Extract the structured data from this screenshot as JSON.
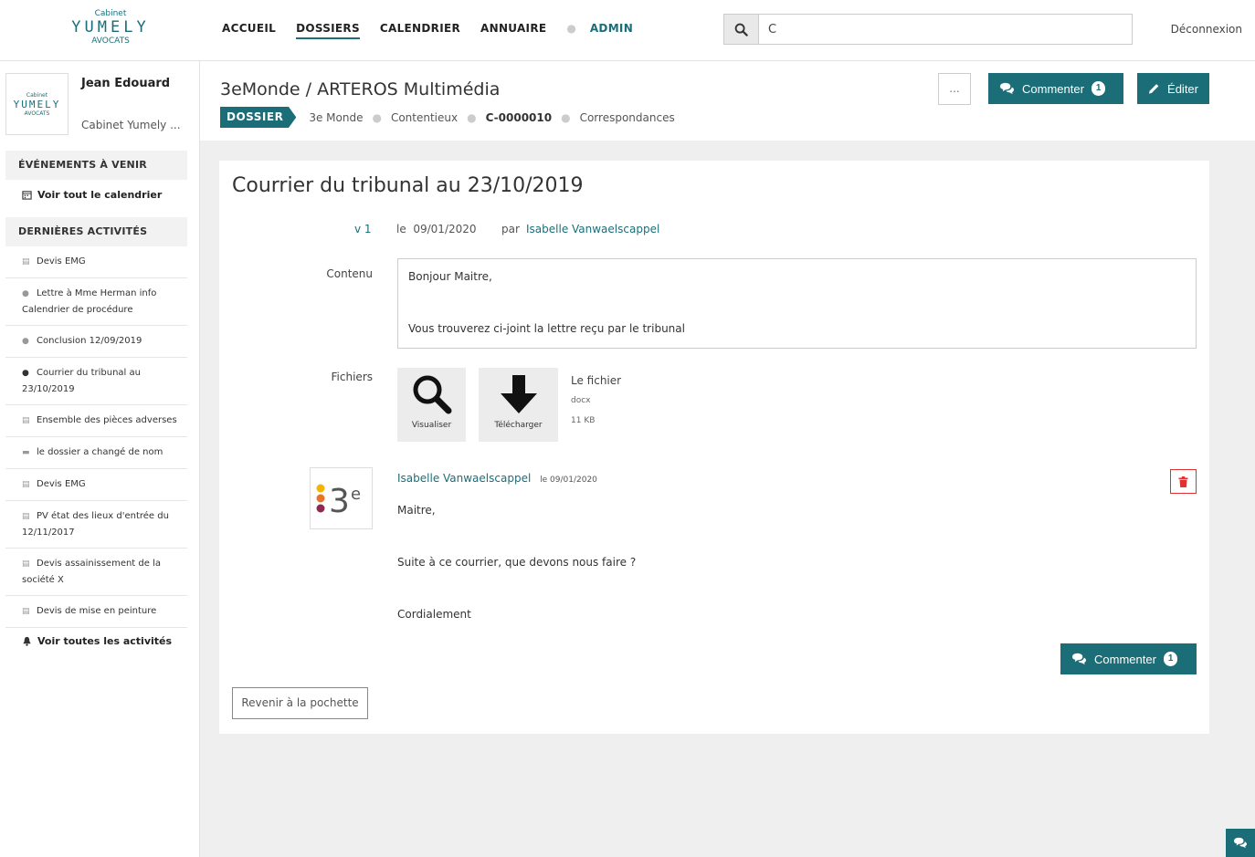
{
  "brand": {
    "top": "Cabinet",
    "name": "YUMELY",
    "sub": "AVOCATS"
  },
  "nav": {
    "home": "ACCUEIL",
    "folders": "DOSSIERS",
    "calendar": "CALENDRIER",
    "directory": "ANNUAIRE",
    "admin": "ADMIN"
  },
  "search": {
    "value": "C",
    "icon": "search-icon"
  },
  "logout": "Déconnexion",
  "profile": {
    "name": "Jean Edouard",
    "firm": "Cabinet Yumely ..."
  },
  "sidebar": {
    "events_header": "ÉVÉNEMENTS À VENIR",
    "calendar_link": "Voir tout le calendrier",
    "activities_header": "DERNIÈRES ACTIVITÉS",
    "activities": [
      {
        "icon": "document-icon",
        "label": "Devis EMG"
      },
      {
        "icon": "comment-icon",
        "label": "Lettre à Mme Herman info Calendrier de procédure"
      },
      {
        "icon": "comment-icon",
        "label": "Conclusion 12/09/2019"
      },
      {
        "icon": "comment-icon-dark",
        "label": "Courrier du tribunal au 23/10/2019"
      },
      {
        "icon": "document-icon",
        "label": "Ensemble des pièces adverses"
      },
      {
        "icon": "folder-icon",
        "label": "le dossier a changé de nom"
      },
      {
        "icon": "document-icon",
        "label": "Devis EMG"
      },
      {
        "icon": "document-icon",
        "label": "PV état des lieux d'entrée du 12/11/2017"
      },
      {
        "icon": "document-icon",
        "label": "Devis assainissement de la société X"
      },
      {
        "icon": "document-icon",
        "label": "Devis de mise en peinture"
      }
    ],
    "all_activities": "Voir toutes les activités"
  },
  "header": {
    "title": "3eMonde / ARTEROS Multimédia",
    "badge": "DOSSIER",
    "crumbs": [
      "3e Monde",
      "Contentieux",
      "C-0000010",
      "Correspondances"
    ],
    "more": "...",
    "comment_label": "Commenter",
    "comment_count": "1",
    "edit_label": "Éditer"
  },
  "doc": {
    "title": "Courrier du tribunal au 23/10/2019",
    "version": "v 1",
    "date_prefix": "le",
    "date": "09/01/2020",
    "by": "par",
    "author": "Isabelle Vanwaelscappel",
    "content_label": "Contenu",
    "content_line1": "Bonjour Maitre,",
    "content_line2": "Vous trouverez ci-joint la lettre reçu par le tribunal",
    "files_label": "Fichiers",
    "view_label": "Visualiser",
    "download_label": "Télécharger",
    "file_name": "Le fichier",
    "file_type": "docx",
    "file_size": "11 KB"
  },
  "comment": {
    "avatar_text": "3e",
    "author": "Isabelle Vanwaelscappel",
    "date": "le  09/01/2020",
    "lines": [
      "Maitre,",
      "Suite à ce courrier, que devons nous faire ?",
      "Cordialement"
    ],
    "button_label": "Commenter",
    "button_count": "1"
  },
  "back_label": "Revenir à la pochette",
  "colors": {
    "accent": "#1b6e78",
    "danger": "#dd3333"
  }
}
